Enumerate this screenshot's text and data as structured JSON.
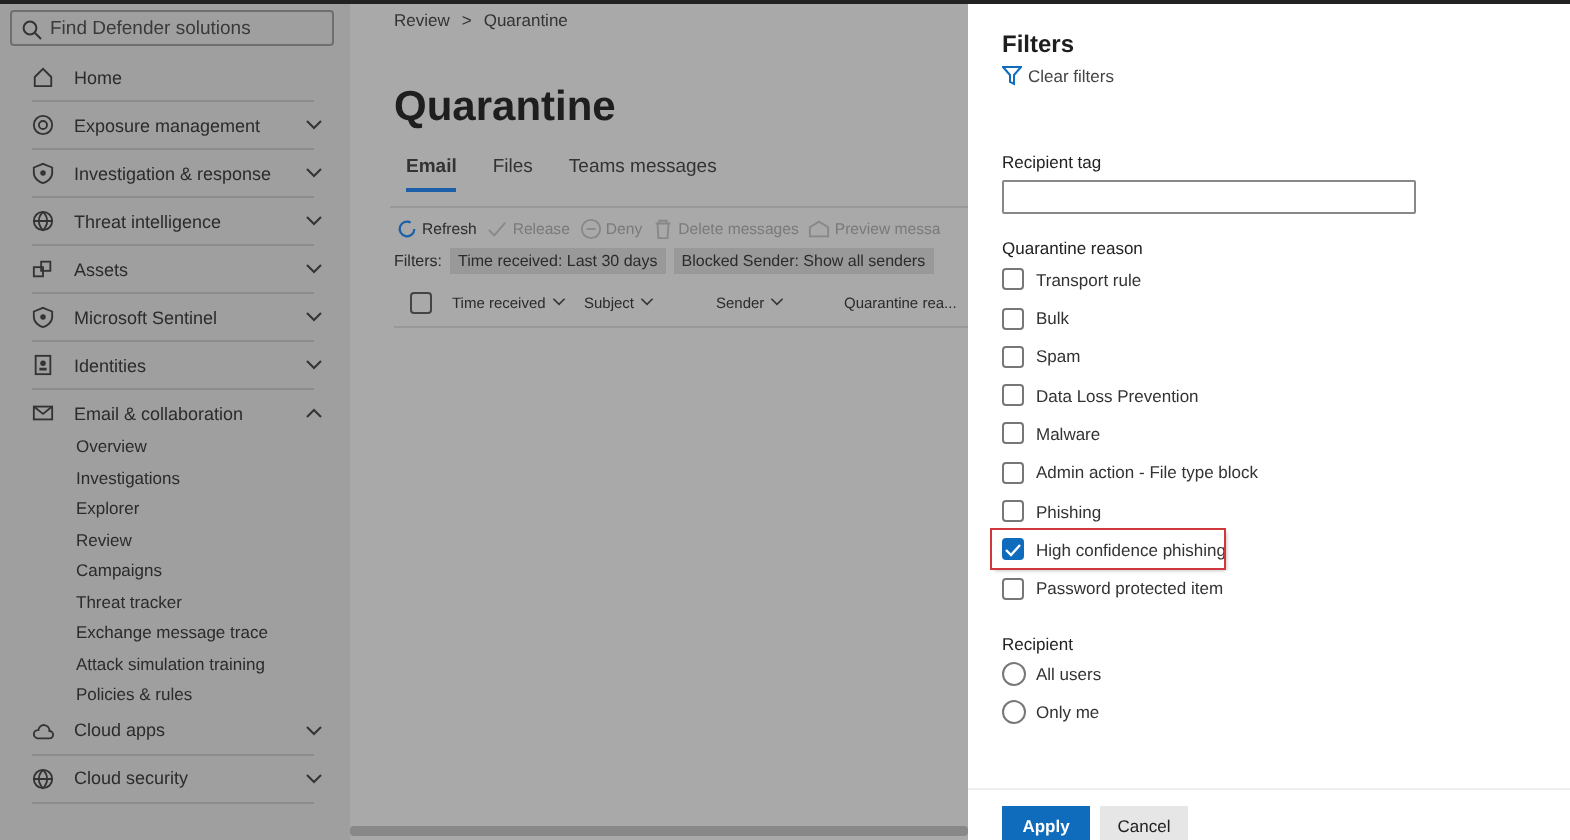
{
  "sidebar": {
    "search": {
      "placeholder": "Find Defender solutions"
    },
    "items": [
      {
        "label": "Home",
        "kind": "link"
      },
      {
        "label": "Exposure management",
        "kind": "group",
        "expanded": false
      },
      {
        "label": "Investigation & response",
        "kind": "group",
        "expanded": false
      },
      {
        "label": "Threat intelligence",
        "kind": "group",
        "expanded": false
      },
      {
        "label": "Assets",
        "kind": "group",
        "expanded": false
      },
      {
        "label": "Microsoft Sentinel",
        "kind": "group",
        "expanded": false
      },
      {
        "label": "Identities",
        "kind": "group",
        "expanded": false
      },
      {
        "label": "Email & collaboration",
        "kind": "group",
        "expanded": true,
        "children": [
          "Overview",
          "Investigations",
          "Explorer",
          "Review",
          "Campaigns",
          "Threat tracker",
          "Exchange message trace",
          "Attack simulation training",
          "Policies & rules"
        ]
      },
      {
        "label": "Cloud apps",
        "kind": "group",
        "expanded": false
      },
      {
        "label": "Cloud security",
        "kind": "group",
        "expanded": false
      }
    ]
  },
  "breadcrumb": {
    "items": [
      "Review",
      "Quarantine"
    ],
    "separator": ">"
  },
  "page_title": "Quarantine",
  "tabs": [
    {
      "label": "Email",
      "selected": true
    },
    {
      "label": "Files",
      "selected": false
    },
    {
      "label": "Teams messages",
      "selected": false
    }
  ],
  "toolbar": [
    {
      "label": "Refresh",
      "disabled": false
    },
    {
      "label": "Release",
      "disabled": true
    },
    {
      "label": "Deny",
      "disabled": true
    },
    {
      "label": "Delete messages",
      "disabled": true
    },
    {
      "label": "Preview messa",
      "disabled": true
    }
  ],
  "filters": {
    "label": "Filters:",
    "chips": [
      "Time received: Last 30 days",
      "Blocked Sender: Show all senders"
    ]
  },
  "table": {
    "select_all_checked": false,
    "columns": [
      {
        "label": "Time received",
        "sortable": true
      },
      {
        "label": "Subject",
        "sortable": true
      },
      {
        "label": "Sender",
        "sortable": true
      },
      {
        "label": "Quarantine rea..."
      }
    ]
  },
  "panel": {
    "title": "Filters",
    "clear": "Clear filters",
    "recipient_tag": {
      "label": "Recipient tag"
    },
    "reason": {
      "label": "Quarantine reason",
      "options": [
        {
          "label": "Transport rule",
          "checked": false,
          "highlighted": false
        },
        {
          "label": "Bulk",
          "checked": false,
          "highlighted": false
        },
        {
          "label": "Spam",
          "checked": false,
          "highlighted": false
        },
        {
          "label": "Data Loss Prevention",
          "checked": false,
          "highlighted": false
        },
        {
          "label": "Malware",
          "checked": false,
          "highlighted": false
        },
        {
          "label": "Admin action - File type block",
          "checked": false,
          "highlighted": false
        },
        {
          "label": "Phishing",
          "checked": false,
          "highlighted": false
        },
        {
          "label": "High confidence phishing",
          "checked": true,
          "highlighted": true
        },
        {
          "label": "Password protected item",
          "checked": false,
          "highlighted": false
        }
      ]
    },
    "recipient": {
      "label": "Recipient",
      "options": [
        {
          "label": "All users",
          "selected": false
        },
        {
          "label": "Only me",
          "selected": false
        }
      ]
    },
    "buttons": [
      {
        "label": "Apply",
        "kind": "primary"
      },
      {
        "label": "Cancel",
        "kind": "secondary"
      }
    ]
  }
}
